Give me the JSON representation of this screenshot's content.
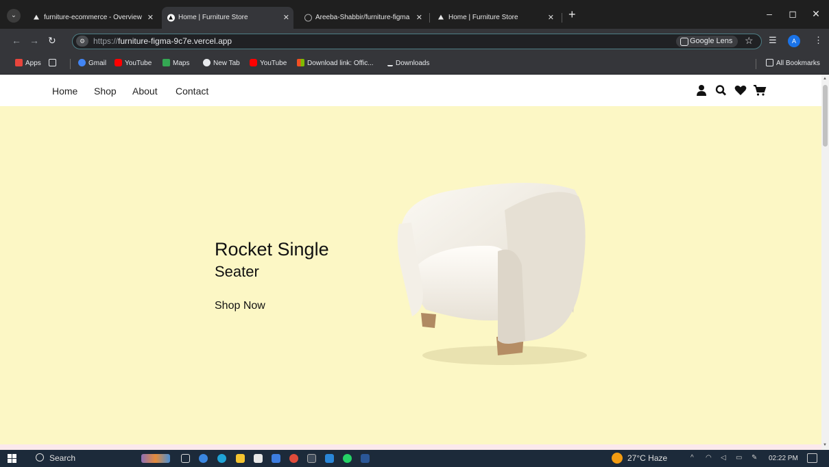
{
  "browser": {
    "tabs": [
      {
        "title": "furniture-ecommerce - Overview",
        "favicon": "vercel-icon",
        "active": false
      },
      {
        "title": "Home | Furniture Store",
        "favicon": "vercel-icon",
        "active": true
      },
      {
        "title": "Areeba-Shabbir/furniture-figma",
        "favicon": "github-icon",
        "active": false
      },
      {
        "title": "Home | Furniture Store",
        "favicon": "vercel-icon",
        "active": false
      }
    ],
    "new_tab": "+",
    "close_glyph": "✕",
    "url_scheme": "https://",
    "url_host": "furniture-figma-9c7e.vercel.app",
    "google_lens": "Google Lens",
    "avatar_letter": "A",
    "bookmarks": [
      {
        "label": "Apps",
        "icon": "apps-grid-icon",
        "color": "#e8453c"
      },
      {
        "label": "",
        "icon": "qr-icon",
        "color": "#e8eaed"
      },
      {
        "label": "Gmail",
        "icon": "google-icon",
        "color": "#4285f4"
      },
      {
        "label": "YouTube",
        "icon": "youtube-icon",
        "color": "#ff0000"
      },
      {
        "label": "Maps",
        "icon": "maps-icon",
        "color": "#34a853"
      },
      {
        "label": "New Tab",
        "icon": "globe-icon",
        "color": "#e8eaed"
      },
      {
        "label": "YouTube",
        "icon": "youtube-icon",
        "color": "#ff0000"
      },
      {
        "label": "Download link: Offic...",
        "icon": "office-icon",
        "color": "#f25022"
      },
      {
        "label": "Downloads",
        "icon": "download-icon",
        "color": "#e8eaed"
      }
    ],
    "all_bookmarks": "All Bookmarks"
  },
  "site": {
    "nav": [
      "Home",
      "Shop",
      "About",
      "Contact"
    ],
    "icons": [
      "user-icon",
      "search-icon",
      "heart-icon",
      "cart-icon"
    ],
    "hero": {
      "title": "Rocket Single",
      "subtitle": "Seater",
      "cta": "Shop Now",
      "background": "#fcf7c5"
    }
  },
  "taskbar": {
    "search_placeholder": "Search",
    "weather": "27°C  Haze",
    "time": "02:22 PM"
  }
}
